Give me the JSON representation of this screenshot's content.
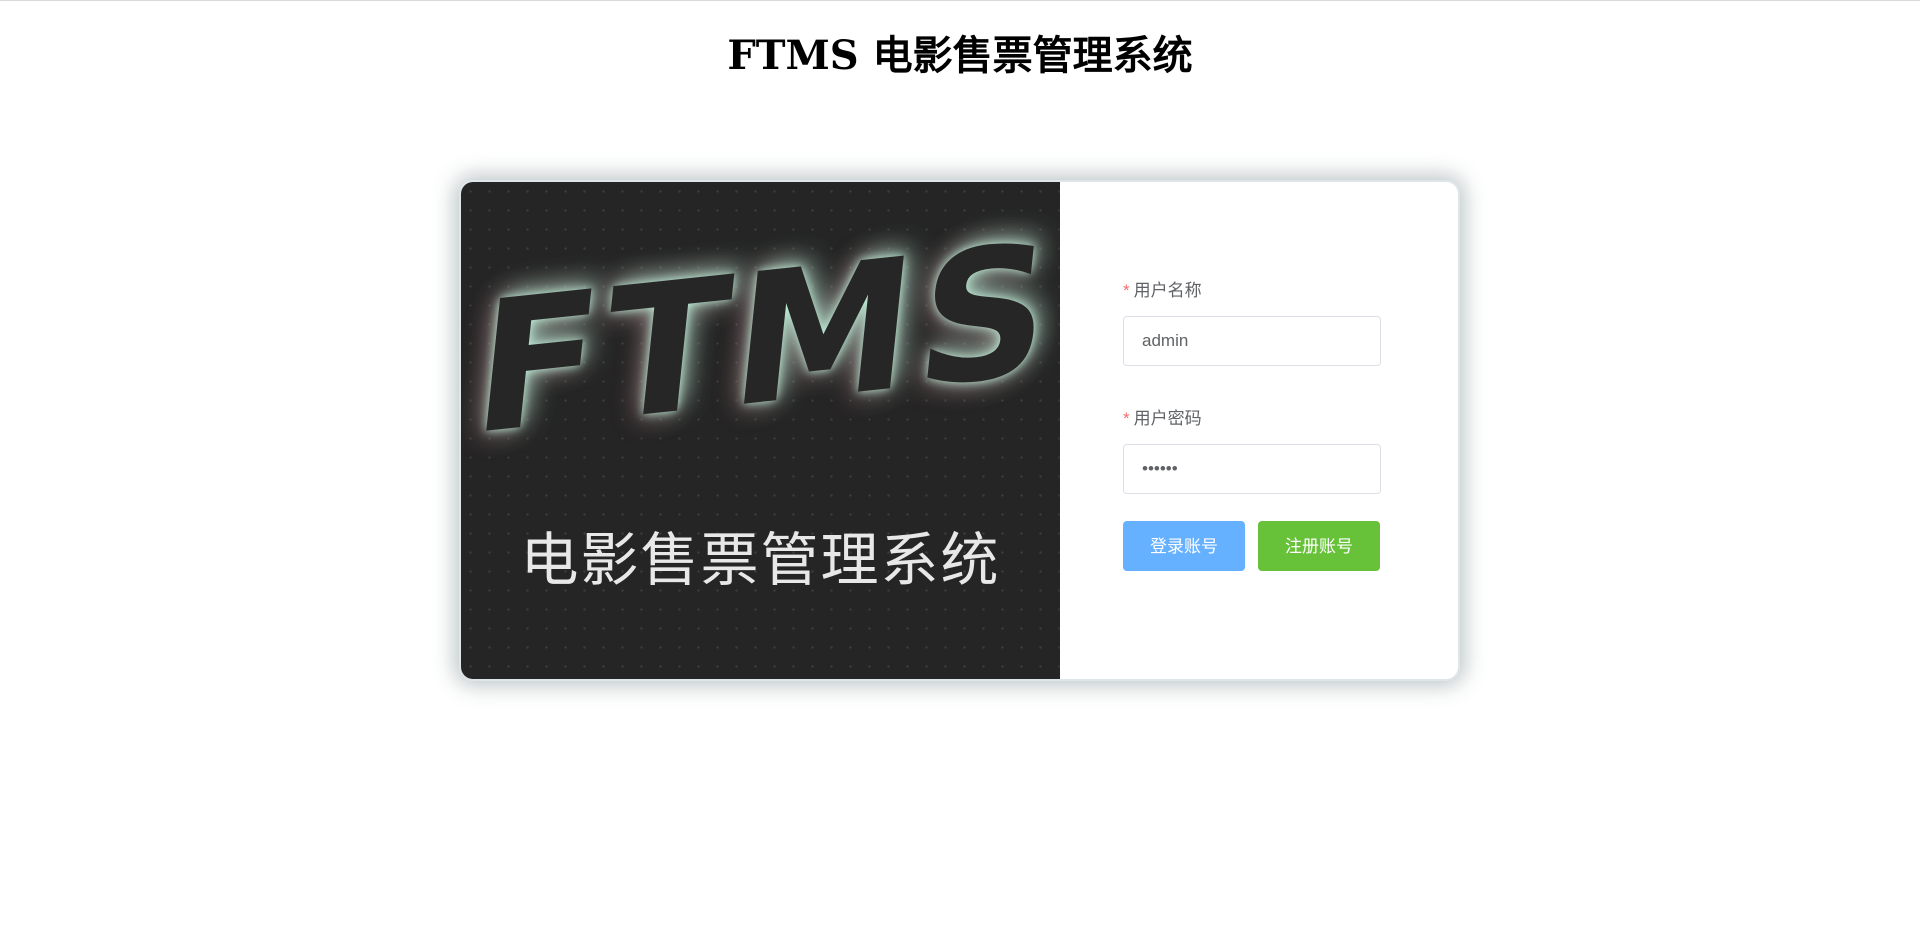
{
  "page": {
    "title": "FTMS 电影售票管理系统"
  },
  "banner": {
    "logo_text": "FTMS",
    "subtitle": "电影售票管理系统"
  },
  "form": {
    "username": {
      "label": "用户名称",
      "required_mark": "*",
      "value": "admin"
    },
    "password": {
      "label": "用户密码",
      "required_mark": "*",
      "value": "••••••"
    },
    "login_button": "登录账号",
    "register_button": "注册账号"
  },
  "colors": {
    "login_button": "#66b1ff",
    "register_button": "#67c23a",
    "required": "#f56c6c",
    "banner_bg": "#252525",
    "logo_glow": "#a8e6cf"
  }
}
